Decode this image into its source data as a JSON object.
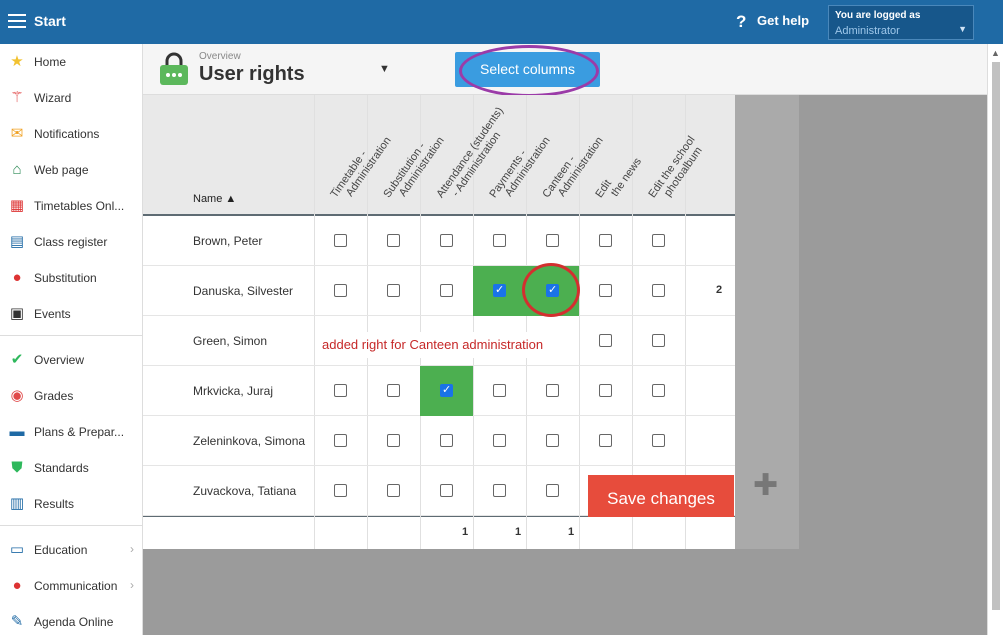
{
  "topbar": {
    "start_label": "Start",
    "help_label": "Get help",
    "login_top": "You are logged as",
    "login_user": "Administrator"
  },
  "sidebar": {
    "items": [
      {
        "label": "Home",
        "icon": "star-icon"
      },
      {
        "label": "Wizard",
        "icon": "wand-icon"
      },
      {
        "label": "Notifications",
        "icon": "envelope-icon"
      },
      {
        "label": "Web page",
        "icon": "house-icon"
      },
      {
        "label": "Timetables Onl...",
        "icon": "calendar-grid-icon"
      },
      {
        "label": "Class register",
        "icon": "book-icon"
      },
      {
        "label": "Substitution",
        "icon": "person-icon"
      },
      {
        "label": "Events",
        "icon": "calendar-icon"
      },
      {
        "label": "Overview",
        "icon": "check-circle-icon"
      },
      {
        "label": "Grades",
        "icon": "grades-icon"
      },
      {
        "label": "Plans & Prepar...",
        "icon": "briefcase-icon"
      },
      {
        "label": "Standards",
        "icon": "shield-check-icon"
      },
      {
        "label": "Results",
        "icon": "bar-chart-icon"
      },
      {
        "label": "Education",
        "icon": "open-book-icon"
      },
      {
        "label": "Communication",
        "icon": "chat-icon"
      },
      {
        "label": "Agenda Online",
        "icon": "pen-icon"
      }
    ]
  },
  "header": {
    "overview_small": "Overview",
    "title": "User rights",
    "select_columns": "Select columns"
  },
  "table": {
    "name_header": "Name ▲",
    "columns": [
      [
        "Timetable -",
        "Administration"
      ],
      [
        "Substitution -",
        "Administration"
      ],
      [
        "Attendance (students)",
        "- Administration"
      ],
      [
        "Payments -",
        "Administration"
      ],
      [
        "Canteen -",
        "Administration"
      ],
      [
        "Edit",
        "the news"
      ],
      [
        "Edit the school",
        "photoalbum"
      ]
    ],
    "rows": [
      {
        "name": "Brown, Peter",
        "checks": [
          false,
          false,
          false,
          false,
          false,
          false,
          false
        ],
        "count": ""
      },
      {
        "name": "Danuska, Silvester",
        "checks": [
          false,
          false,
          false,
          true,
          true,
          false,
          false
        ],
        "count": "2"
      },
      {
        "name": "Green, Simon",
        "checks": [
          false,
          false,
          false,
          false,
          false,
          false,
          false
        ],
        "count": ""
      },
      {
        "name": "Mrkvicka, Juraj",
        "checks": [
          false,
          false,
          true,
          false,
          false,
          false,
          false
        ],
        "count": ""
      },
      {
        "name": "Zeleninkova, Simona",
        "checks": [
          false,
          false,
          false,
          false,
          false,
          false,
          false
        ],
        "count": ""
      },
      {
        "name": "Zuvackova, Tatiana",
        "checks": [
          false,
          false,
          false,
          false,
          false,
          false,
          false
        ],
        "count": ""
      }
    ],
    "footer": [
      "",
      "",
      "1",
      "1",
      "1",
      "",
      ""
    ]
  },
  "save_label": "Save changes",
  "annotation": "added right for Canteen administration",
  "colors": {
    "accent": "#1f6aa5",
    "save": "#e74c3c",
    "checked_cell": "#4caf50"
  }
}
